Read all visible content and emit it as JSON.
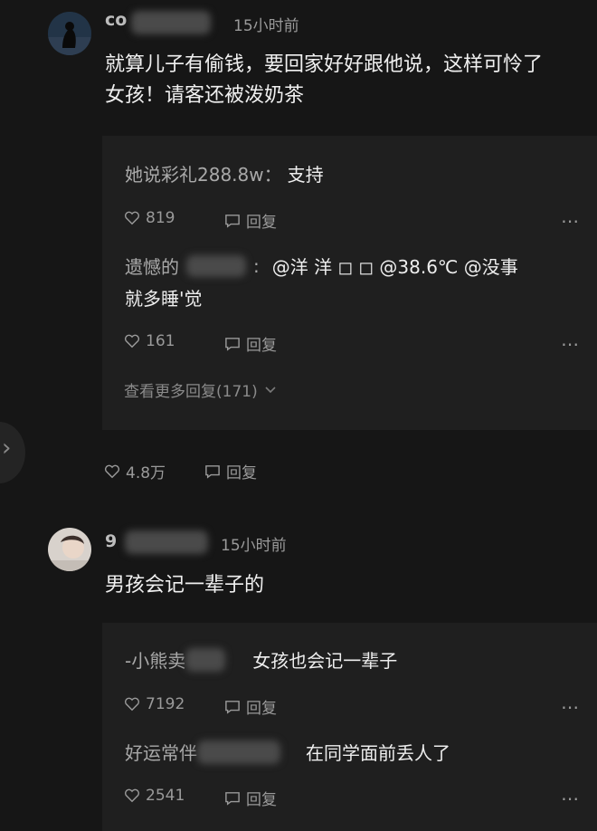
{
  "comments": [
    {
      "username": "co",
      "time": "15小时前",
      "text_line1": "就算儿子有偷钱，要回家好好跟他说，这样可怜了",
      "text_line2": "女孩！请客还被泼奶茶",
      "likes": "4.8万",
      "reply_label": "回复",
      "replies": [
        {
          "name": "她说彩礼288.8w：",
          "text": "支持",
          "likes": "819",
          "reply_label": "回复"
        },
        {
          "name": "遗憾的",
          "text_line1": "@洋 洋 ◻ ◻ @38.6℃ @没事",
          "text_line2": "就多睡'觉",
          "likes": "161",
          "reply_label": "回复"
        }
      ],
      "view_more": "查看更多回复(171)"
    },
    {
      "username": "9",
      "time": "15小时前",
      "text": "男孩会记一辈子的",
      "replies": [
        {
          "name": "-小熊卖",
          "text": "女孩也会记一辈子",
          "likes": "7192",
          "reply_label": "回复"
        },
        {
          "name": "好运常伴",
          "text": "在同学面前丢人了",
          "likes": "2541",
          "reply_label": "回复"
        }
      ]
    }
  ],
  "more_icon": "⋯",
  "side_arrow": "›"
}
